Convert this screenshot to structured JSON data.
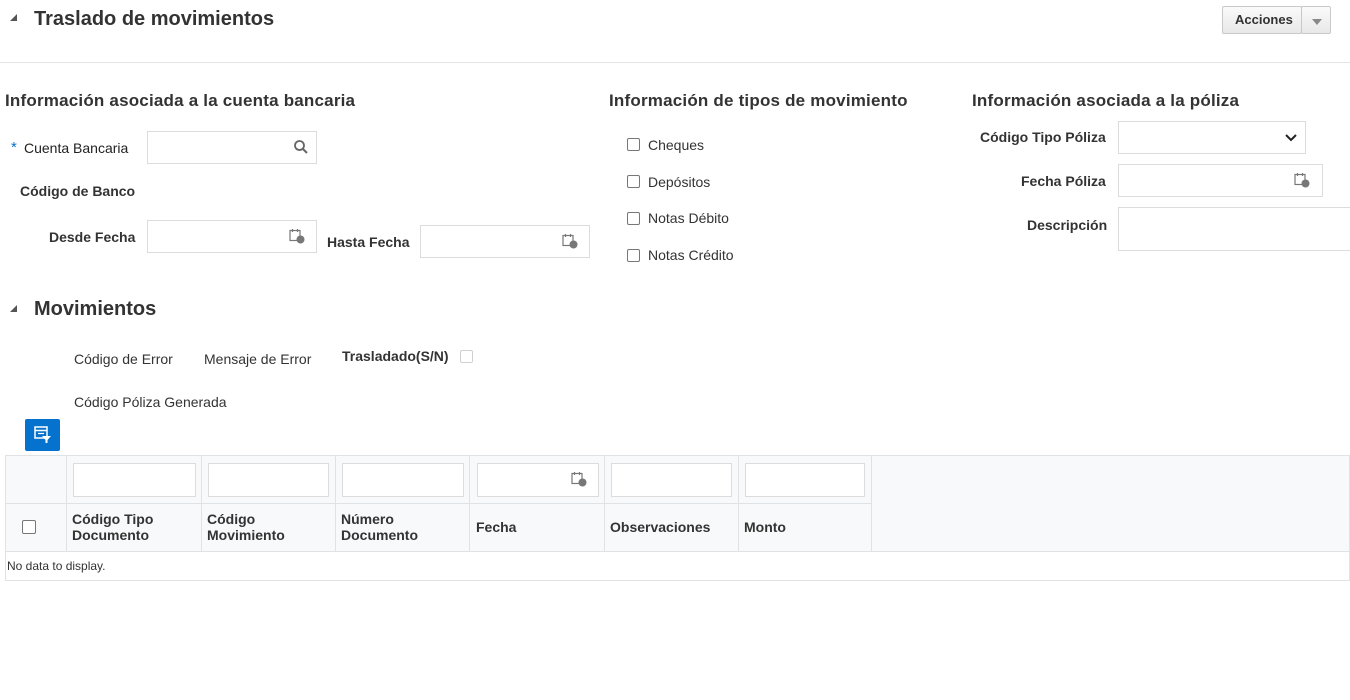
{
  "header": {
    "title": "Traslado de movimientos",
    "actions_label": "Acciones"
  },
  "bank": {
    "section_title": "Información asociada a la cuenta bancaria",
    "required_mark": "*",
    "account_label": "Cuenta Bancaria",
    "bank_code_label": "Código de Banco",
    "from_date_label": "Desde Fecha",
    "to_date_label": "Hasta Fecha"
  },
  "movement_types": {
    "section_title": "Información de tipos de movimiento",
    "options": [
      "Cheques",
      "Depósitos",
      "Notas Débito",
      "Notas Crédito"
    ]
  },
  "policy": {
    "section_title": "Información asociada a la póliza",
    "type_code_label": "Código Tipo Póliza",
    "date_label": "Fecha Póliza",
    "description_label": "Descripción"
  },
  "movements": {
    "section_title": "Movimientos",
    "error_code_label": "Código de Error",
    "error_message_label": "Mensaje de Error",
    "transferred_label": "Trasladado(S/N)",
    "generated_policy_label": "Código Póliza Generada",
    "table": {
      "columns": [
        {
          "l1": "Código Tipo",
          "l2": "Documento"
        },
        {
          "l1": "Código",
          "l2": "Movimiento"
        },
        {
          "l1": "Número",
          "l2": "Documento"
        },
        {
          "l1": "Fecha",
          "l2": ""
        },
        {
          "l1": "Observaciones",
          "l2": ""
        },
        {
          "l1": "Monto",
          "l2": ""
        }
      ],
      "empty_message": "No data to display."
    }
  },
  "colors": {
    "accent": "#0572ce",
    "required": "#0572ce",
    "border": "#dcdcdc",
    "table_header_bg": "#f7f9fa"
  },
  "icons": [
    "collapse-triangle-icon",
    "search-icon",
    "calendar-icon",
    "chevron-down-icon",
    "query-by-example-icon"
  ]
}
